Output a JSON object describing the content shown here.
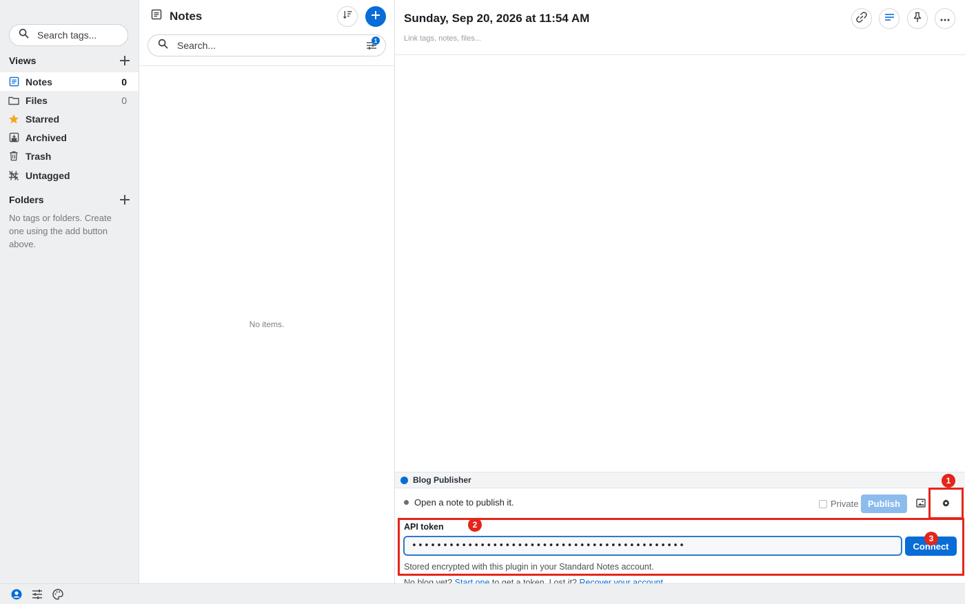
{
  "nav": {
    "tag_search_placeholder": "Search tags...",
    "views_heading": "Views",
    "views": [
      {
        "label": "Notes",
        "count": "0",
        "icon": "notes-icon"
      },
      {
        "label": "Files",
        "count": "0",
        "icon": "folder-icon"
      },
      {
        "label": "Starred",
        "count": "",
        "icon": "star-icon"
      },
      {
        "label": "Archived",
        "count": "",
        "icon": "archive-icon"
      },
      {
        "label": "Trash",
        "count": "",
        "icon": "trash-icon"
      },
      {
        "label": "Untagged",
        "count": "",
        "icon": "untagged-icon"
      }
    ],
    "folders_heading": "Folders",
    "folders_empty": "No tags or folders. Create one using the add button above."
  },
  "list": {
    "title": "Notes",
    "search_placeholder": "Search...",
    "filter_badge": "1",
    "empty": "No items."
  },
  "editor": {
    "title": "Sunday, Sep 20, 2026 at 11:54 AM",
    "link_placeholder": "Link tags, notes, files..."
  },
  "plugin": {
    "name": "Blog Publisher",
    "status": "Open a note to publish it.",
    "private_label": "Private",
    "publish_label": "Publish",
    "token_label": "API token",
    "token_value": "••••••••••••••••••••••••••••••••••••••••••••",
    "connect_label": "Connect",
    "hint": "Stored encrypted with this plugin in your Standard Notes account.",
    "hint2_prefix": "No blog yet?",
    "hint2_link1": "Start one",
    "hint2_middle": "to get a token. Lost it?",
    "hint2_link2": "Recover your account"
  },
  "annotations": [
    "1",
    "2",
    "3"
  ],
  "colors": {
    "accent": "#086dd6",
    "annotation": "#e3251b",
    "sidebar_bg": "#eeeff1",
    "star": "#f5a623"
  }
}
